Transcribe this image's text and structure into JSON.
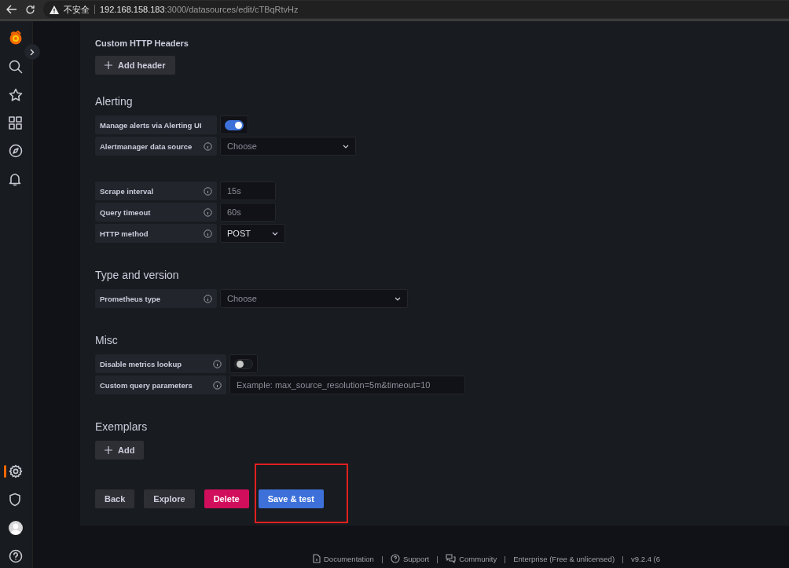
{
  "browser": {
    "security_label": "不安全",
    "url_host": "192.168.158.183",
    "url_path": ":3000/datasources/edit/cTBqRtvHz"
  },
  "nav_items": [
    {
      "kind": "logo",
      "selected": false
    },
    {
      "kind": "search",
      "selected": false
    },
    {
      "kind": "star",
      "selected": false
    },
    {
      "kind": "grid",
      "selected": false
    },
    {
      "kind": "compass",
      "selected": false
    },
    {
      "kind": "bell",
      "selected": false
    },
    {
      "kind": "gear",
      "selected": true
    },
    {
      "kind": "shield",
      "selected": false
    },
    {
      "kind": "avatar",
      "selected": false
    },
    {
      "kind": "help",
      "selected": false
    }
  ],
  "sections": [
    {
      "title": "Custom HTTP Headers",
      "kind": "subheading",
      "button": "Add header"
    },
    {
      "title": "Alerting",
      "kind": "heading",
      "groups": [
        [
          {
            "kind": "switch",
            "label": "Manage alerts via Alerting UI",
            "info": false,
            "on": true
          },
          {
            "kind": "select",
            "label": "Alertmanager data source",
            "info": true,
            "placeholder": "Choose"
          }
        ],
        [
          {
            "kind": "input",
            "label": "Scrape interval",
            "info": true,
            "placeholder": "15s"
          },
          {
            "kind": "input",
            "label": "Query timeout",
            "info": true,
            "placeholder": "60s"
          },
          {
            "kind": "select",
            "label": "HTTP method",
            "info": true,
            "value": "POST"
          }
        ]
      ]
    },
    {
      "title": "Type and version",
      "kind": "heading",
      "groups": [
        [
          {
            "kind": "select",
            "label": "Prometheus type",
            "info": true,
            "placeholder": "Choose"
          }
        ]
      ]
    },
    {
      "title": "Misc",
      "kind": "heading",
      "groups": [
        [
          {
            "kind": "switch",
            "label": "Disable metrics lookup",
            "info": true,
            "on": false
          },
          {
            "kind": "input",
            "label": "Custom query parameters",
            "info": true,
            "placeholder": "Example: max_source_resolution=5m&timeout=10"
          }
        ]
      ]
    },
    {
      "title": "Exemplars",
      "kind": "heading",
      "button": "Add"
    }
  ],
  "actions": [
    {
      "label": "Back",
      "kind": "secondary",
      "highlighted": false
    },
    {
      "label": "Explore",
      "kind": "secondary",
      "highlighted": false
    },
    {
      "label": "Delete",
      "kind": "destructive",
      "highlighted": false
    },
    {
      "label": "Save & test",
      "kind": "primary",
      "highlighted": true
    }
  ],
  "footer": [
    {
      "label": "Documentation"
    },
    {
      "label": "Support"
    },
    {
      "label": "Community"
    },
    {
      "label": "Enterprise (Free & unlicensed)"
    },
    {
      "label": "v9.2.4 (6"
    }
  ]
}
